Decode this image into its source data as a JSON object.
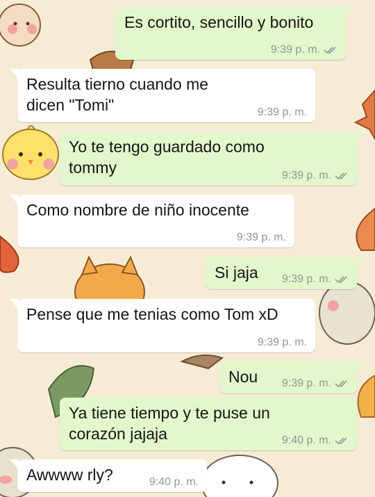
{
  "chat": {
    "messages": [
      {
        "direction": "outgoing",
        "text": "Es cortito, sencillo y bonito",
        "time": "9:39 p. m.",
        "status_icon": "double-check-icon"
      },
      {
        "direction": "incoming",
        "text": "Resulta tierno cuando me dicen \"Tomi\"",
        "time": "9:39 p. m."
      },
      {
        "direction": "outgoing",
        "text": "Yo te tengo guardado como tommy",
        "time": "9:39 p. m.",
        "status_icon": "double-check-icon"
      },
      {
        "direction": "incoming",
        "text": "Como nombre de niño inocente",
        "time": "9:39 p. m."
      },
      {
        "direction": "outgoing",
        "text": "Si jaja",
        "time": "9:39 p. m.",
        "status_icon": "double-check-icon"
      },
      {
        "direction": "incoming",
        "text": "Pense que me tenias como Tom xD",
        "time": "9:39 p. m."
      },
      {
        "direction": "outgoing",
        "text": "Nou",
        "time": "9:39 p. m.",
        "status_icon": "double-check-icon"
      },
      {
        "direction": "outgoing",
        "text": "Ya tiene tiempo y te puse un corazón jajaja",
        "time": "9:40 p. m.",
        "status_icon": "double-check-icon"
      },
      {
        "direction": "incoming",
        "text": "Awwww rly?",
        "time": "9:40 p. m."
      }
    ]
  },
  "colors": {
    "wallpaper": "#f6ecd6",
    "outgoing_bubble": "#e2f7cb",
    "incoming_bubble": "#ffffff",
    "meta_text": "#8d9794"
  }
}
